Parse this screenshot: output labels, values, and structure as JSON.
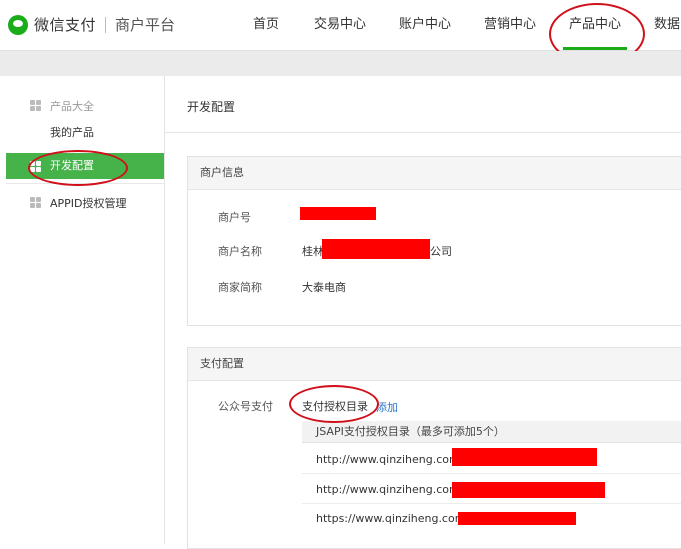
{
  "header": {
    "brand": "微信支付",
    "sub": "商户平台",
    "nav": [
      {
        "label": "首页"
      },
      {
        "label": "交易中心"
      },
      {
        "label": "账户中心"
      },
      {
        "label": "营销中心"
      },
      {
        "label": "产品中心",
        "active": true
      },
      {
        "label": "数据中心"
      }
    ]
  },
  "sidebar": {
    "group_label": "产品大全",
    "items": [
      {
        "label": "我的产品"
      },
      {
        "label": "开发配置",
        "active": true
      },
      {
        "label": "APPID授权管理"
      }
    ]
  },
  "main": {
    "title": "开发配置",
    "merchant": {
      "title": "商户信息",
      "rows": [
        {
          "label": "商户号",
          "value": ""
        },
        {
          "label": "商户名称",
          "value_prefix": "桂林",
          "value_suffix": "公司"
        },
        {
          "label": "商家简称",
          "value": "大泰电商"
        }
      ]
    },
    "pay": {
      "title": "支付配置",
      "label": "公众号支付",
      "tab_label": "支付授权目录",
      "add_label": "添加",
      "table_header": "JSAPI支付授权目录（最多可添加5个）",
      "urls": [
        "http://www.qinziheng.com",
        "http://www.qinziheng.com",
        "https://www.qinziheng.com"
      ]
    }
  },
  "colors": {
    "accent": "#1aad19",
    "redaction": "#ff0000",
    "annotation": "#d0101b",
    "link": "#2a74c7"
  }
}
